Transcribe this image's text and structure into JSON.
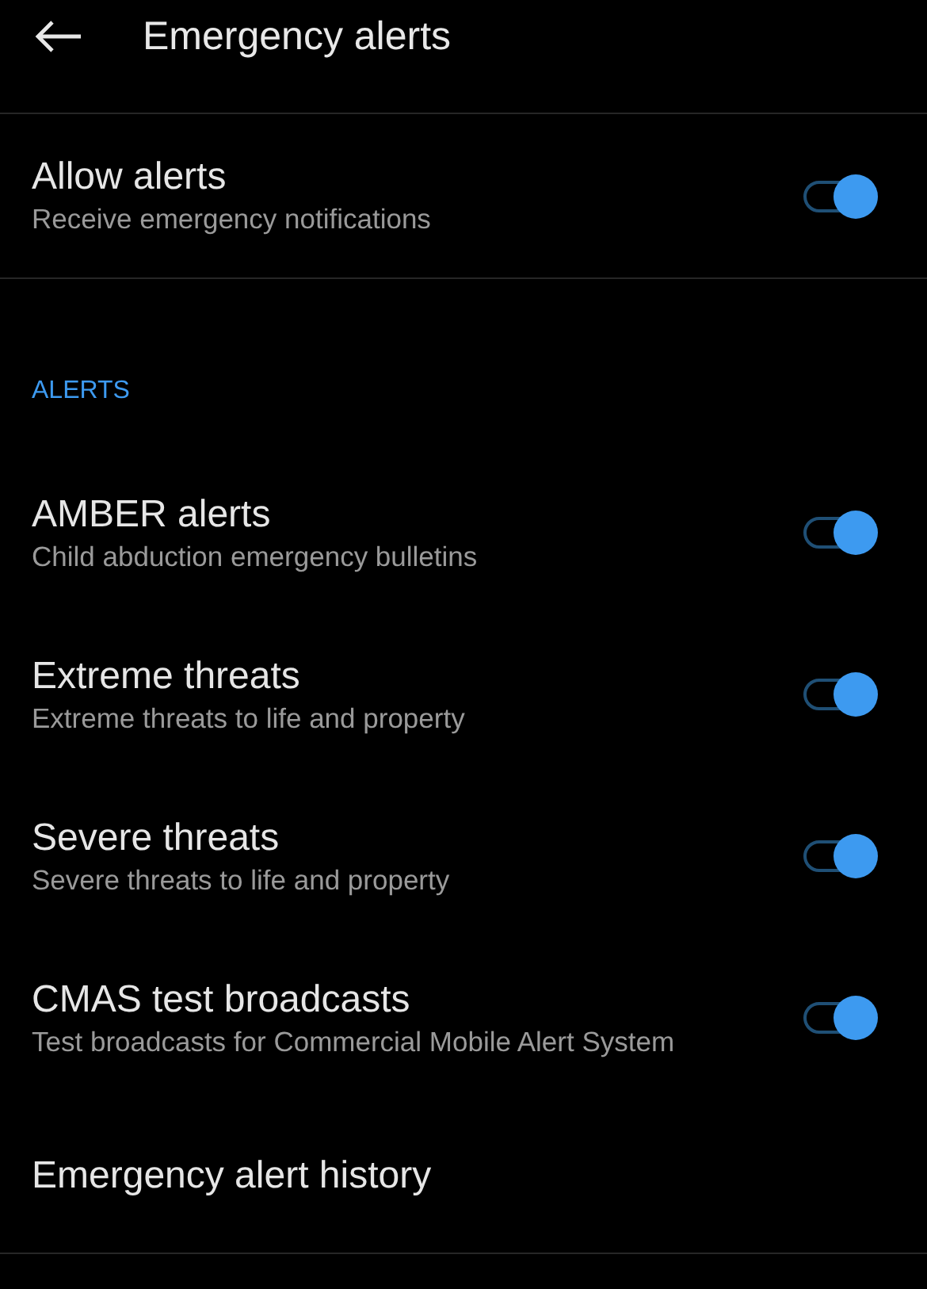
{
  "header": {
    "title": "Emergency alerts"
  },
  "main_setting": {
    "title": "Allow alerts",
    "subtitle": "Receive emergency notifications",
    "on": true
  },
  "section": {
    "title": "ALERTS"
  },
  "items": [
    {
      "kind": "toggle",
      "title": "AMBER alerts",
      "subtitle": "Child abduction emergency bulletins",
      "on": true
    },
    {
      "kind": "toggle",
      "title": "Extreme threats",
      "subtitle": "Extreme threats to life and property",
      "on": true
    },
    {
      "kind": "toggle",
      "title": "Severe threats",
      "subtitle": "Severe threats to life and property",
      "on": true
    },
    {
      "kind": "toggle",
      "title": "CMAS test broadcasts",
      "subtitle": "Test broadcasts for Commercial Mobile Alert System",
      "on": true
    },
    {
      "kind": "link",
      "title": "Emergency alert history"
    }
  ]
}
